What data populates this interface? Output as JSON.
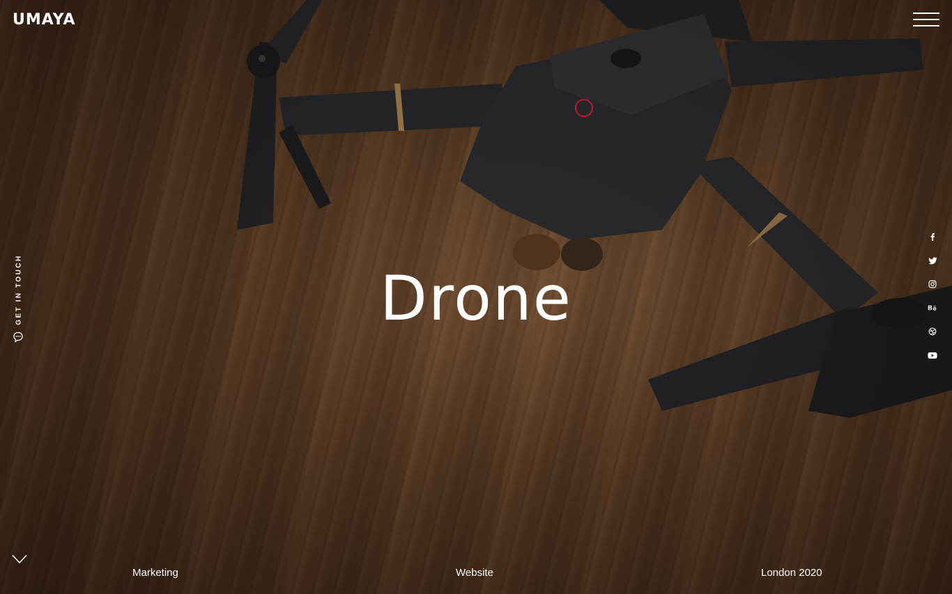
{
  "brand": {
    "logo_text": "UMAYA"
  },
  "nav": {
    "menu_icon": "hamburger-menu-icon"
  },
  "contact": {
    "label": "GET IN TOUCH",
    "icon": "chat-bubble-icon"
  },
  "hero": {
    "title": "Drone"
  },
  "social": [
    {
      "name": "facebook",
      "glyph": "f"
    },
    {
      "name": "twitter",
      "glyph": "t"
    },
    {
      "name": "instagram",
      "glyph": "ig"
    },
    {
      "name": "behance",
      "glyph": "Bē"
    },
    {
      "name": "dribbble",
      "glyph": "db"
    },
    {
      "name": "youtube",
      "glyph": "yt"
    }
  ],
  "project_meta": {
    "category": "Marketing",
    "type": "Website",
    "location_year": "London 2020"
  },
  "scroll": {
    "icon": "chevron-down-icon"
  },
  "colors": {
    "text": "#ffffff",
    "cursor_ring": "#c0182c",
    "wood_base": "#5e3e25"
  }
}
